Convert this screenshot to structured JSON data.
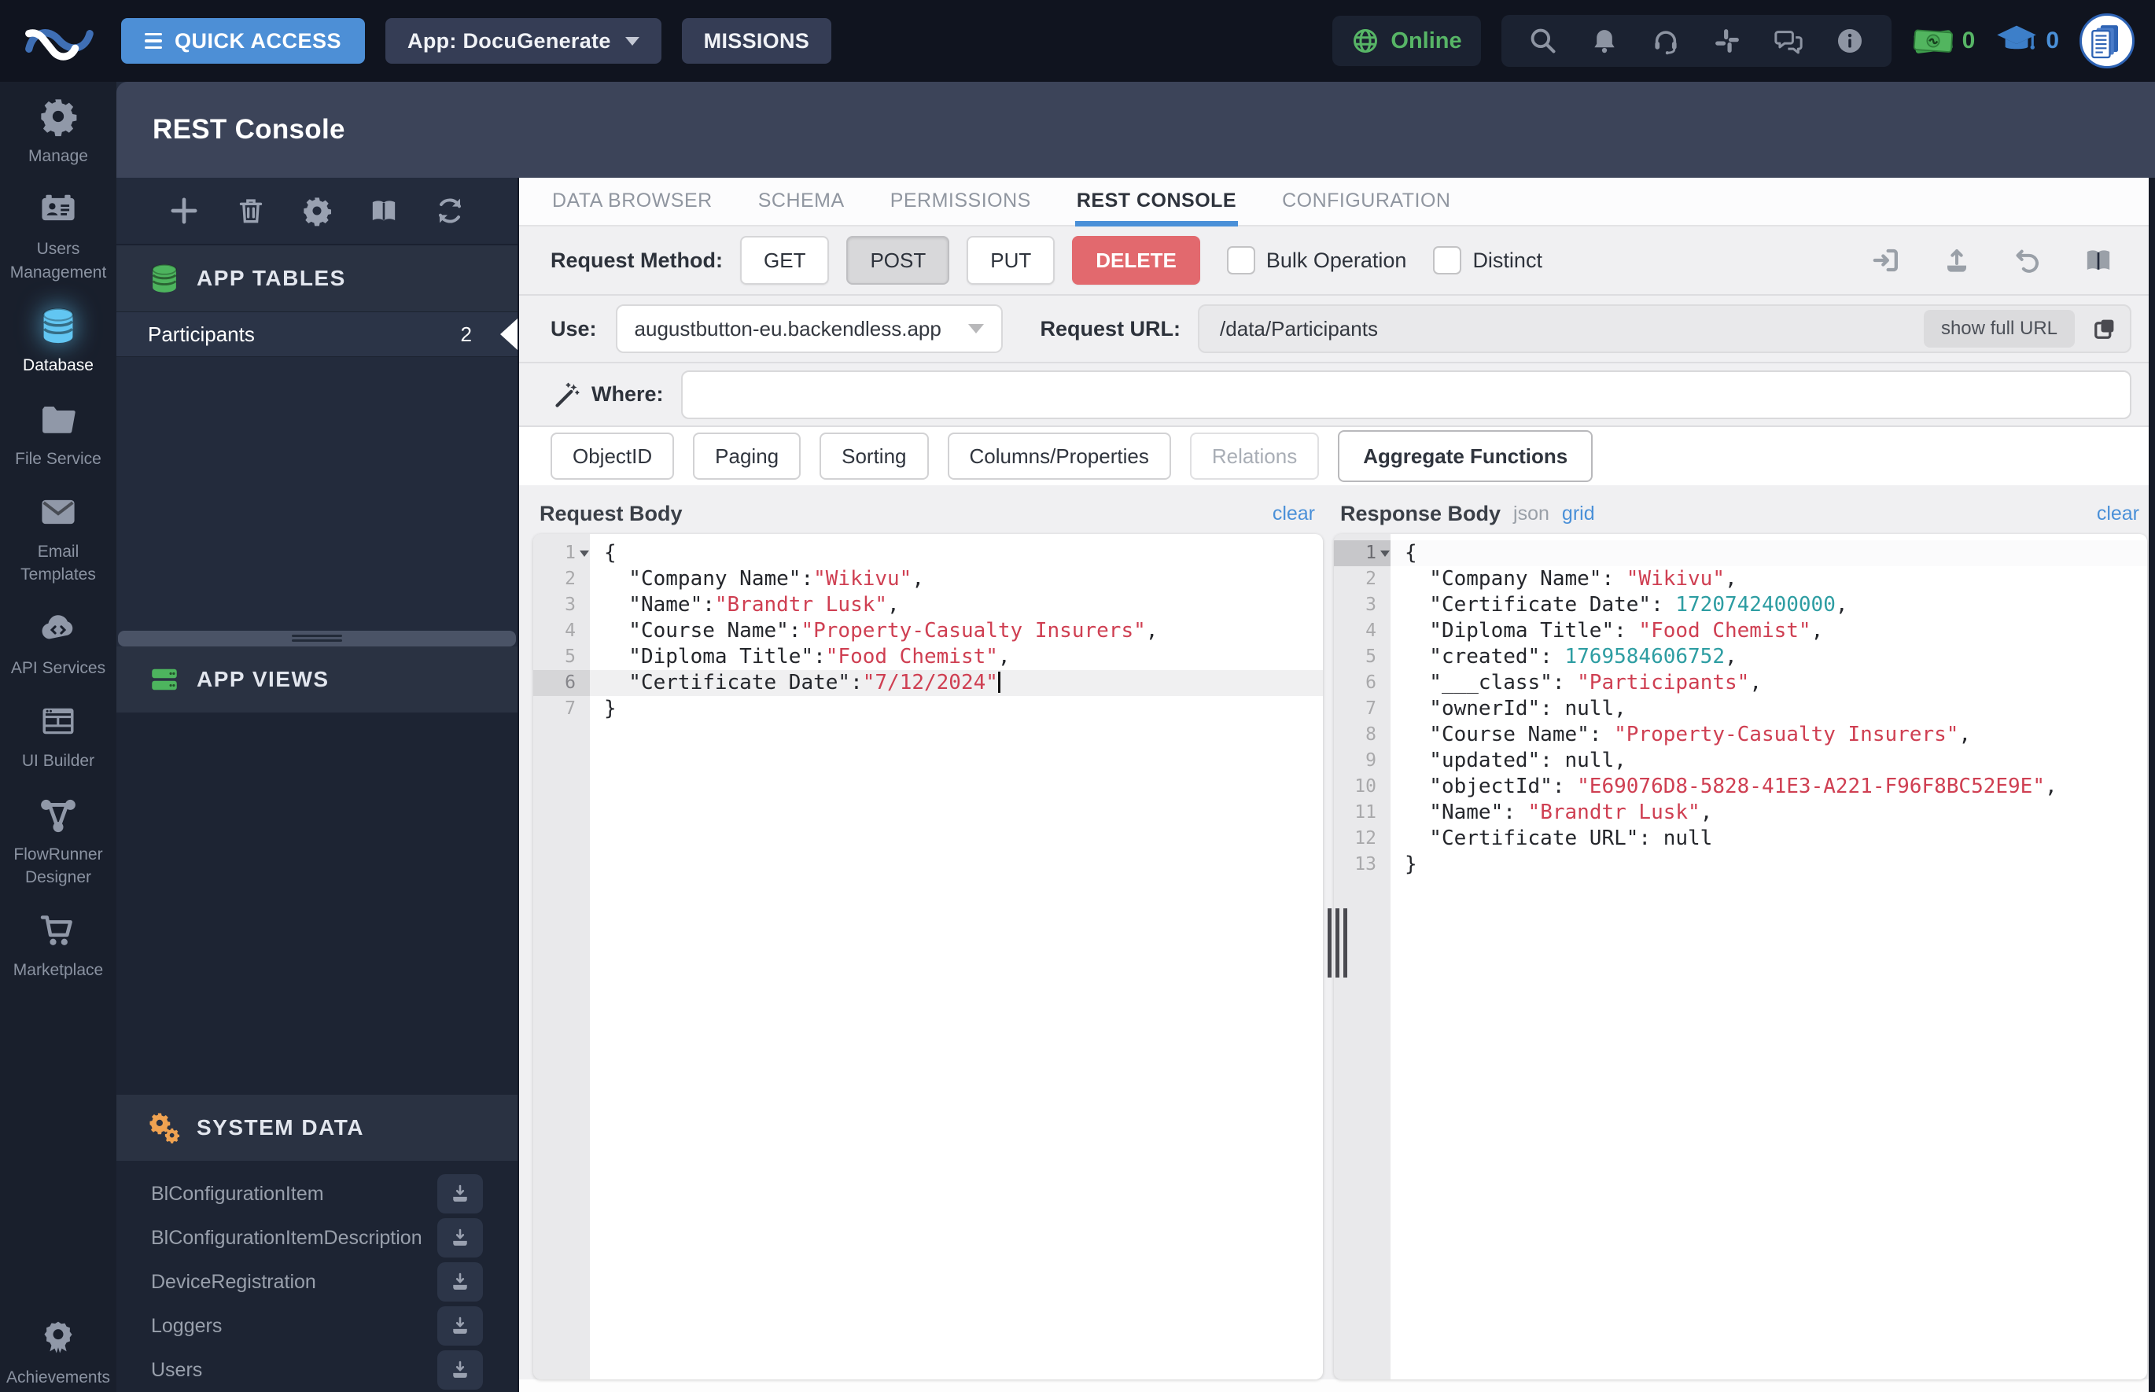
{
  "topbar": {
    "quick_access": "QUICK ACCESS",
    "app_selector": "App: DocuGenerate",
    "missions": "MISSIONS",
    "online": "Online",
    "bucks_count": "0",
    "missions_count": "0"
  },
  "sidebar": {
    "items": [
      {
        "label": "Manage",
        "icon": "gear"
      },
      {
        "label": "Users Management",
        "icon": "id-card"
      },
      {
        "label": "Database",
        "icon": "database",
        "active": true
      },
      {
        "label": "File Service",
        "icon": "folder"
      },
      {
        "label": "Email Templates",
        "icon": "envelope"
      },
      {
        "label": "API Services",
        "icon": "cloud-code"
      },
      {
        "label": "UI Builder",
        "icon": "browser"
      },
      {
        "label": "FlowRunner Designer",
        "icon": "flow"
      },
      {
        "label": "Marketplace",
        "icon": "cart"
      },
      {
        "label": "Achievements",
        "icon": "badge"
      }
    ]
  },
  "page": {
    "title": "REST Console"
  },
  "tables_panel": {
    "app_tables": "APP TABLES",
    "tables": [
      {
        "name": "Participants",
        "count": "2"
      }
    ],
    "app_views": "APP VIEWS",
    "system_data": "SYSTEM DATA",
    "system_tables": [
      "BlConfigurationItem",
      "BlConfigurationItemDescription",
      "DeviceRegistration",
      "Loggers",
      "Users"
    ]
  },
  "tabs": [
    {
      "label": "DATA BROWSER"
    },
    {
      "label": "SCHEMA"
    },
    {
      "label": "PERMISSIONS"
    },
    {
      "label": "REST CONSOLE",
      "active": true
    },
    {
      "label": "CONFIGURATION"
    }
  ],
  "request": {
    "method_label": "Request Method:",
    "methods": [
      {
        "label": "GET",
        "state": "plain"
      },
      {
        "label": "POST",
        "state": "pressed"
      },
      {
        "label": "PUT",
        "state": "plain"
      },
      {
        "label": "DELETE",
        "state": "danger"
      }
    ],
    "bulk_operation": "Bulk Operation",
    "distinct": "Distinct",
    "use_label": "Use:",
    "use_value": "augustbutton-eu.backendless.app",
    "url_label": "Request URL:",
    "url_value": "/data/Participants",
    "show_full_url": "show full URL",
    "where_label": "Where:",
    "where_value": "",
    "filters": [
      {
        "label": "ObjectID"
      },
      {
        "label": "Paging"
      },
      {
        "label": "Sorting"
      },
      {
        "label": "Columns/Properties"
      },
      {
        "label": "Relations",
        "disabled": true
      },
      {
        "label": "Aggregate Functions",
        "emph": true
      }
    ]
  },
  "request_body": {
    "title": "Request Body",
    "clear": "clear",
    "lines": [
      {
        "no": 1,
        "fold": true,
        "segs": [
          [
            "{",
            ""
          ]
        ]
      },
      {
        "no": 2,
        "segs": [
          [
            "  \"Company Name\":",
            ""
          ],
          [
            "\"Wikivu\"",
            "s"
          ],
          [
            ",",
            ""
          ]
        ]
      },
      {
        "no": 3,
        "segs": [
          [
            "  \"Name\":",
            ""
          ],
          [
            "\"Brandtr Lusk\"",
            "s"
          ],
          [
            ",",
            ""
          ]
        ]
      },
      {
        "no": 4,
        "segs": [
          [
            "  \"Course Name\":",
            ""
          ],
          [
            "\"Property-Casualty Insurers\"",
            "s"
          ],
          [
            ",",
            ""
          ]
        ]
      },
      {
        "no": 5,
        "segs": [
          [
            "  \"Diploma Title\":",
            ""
          ],
          [
            "\"Food Chemist\"",
            "s"
          ],
          [
            ",",
            ""
          ]
        ]
      },
      {
        "no": 6,
        "active": true,
        "cursor": true,
        "segs": [
          [
            "  \"Certificate Date\":",
            ""
          ],
          [
            "\"7/12/2024\"",
            "s"
          ]
        ]
      },
      {
        "no": 7,
        "segs": [
          [
            "}",
            ""
          ]
        ]
      }
    ]
  },
  "response_body": {
    "title": "Response Body",
    "mode_json": "json",
    "mode_grid": "grid",
    "clear": "clear",
    "lines": [
      {
        "no": 1,
        "fold": true,
        "hl": true,
        "segs": [
          [
            "{",
            ""
          ]
        ]
      },
      {
        "no": 2,
        "segs": [
          [
            "  \"Company Name\": ",
            ""
          ],
          [
            "\"Wikivu\"",
            "s"
          ],
          [
            ",",
            ""
          ]
        ]
      },
      {
        "no": 3,
        "segs": [
          [
            "  \"Certificate Date\": ",
            ""
          ],
          [
            "1720742400000",
            "n"
          ],
          [
            ",",
            ""
          ]
        ]
      },
      {
        "no": 4,
        "segs": [
          [
            "  \"Diploma Title\": ",
            ""
          ],
          [
            "\"Food Chemist\"",
            "s"
          ],
          [
            ",",
            ""
          ]
        ]
      },
      {
        "no": 5,
        "segs": [
          [
            "  \"created\": ",
            ""
          ],
          [
            "1769584606752",
            "n"
          ],
          [
            ",",
            ""
          ]
        ]
      },
      {
        "no": 6,
        "segs": [
          [
            "  \"___class\": ",
            ""
          ],
          [
            "\"Participants\"",
            "s"
          ],
          [
            ",",
            ""
          ]
        ]
      },
      {
        "no": 7,
        "segs": [
          [
            "  \"ownerId\": null,",
            ""
          ]
        ]
      },
      {
        "no": 8,
        "segs": [
          [
            "  \"Course Name\": ",
            ""
          ],
          [
            "\"Property-Casualty Insurers\"",
            "s"
          ],
          [
            ",",
            ""
          ]
        ]
      },
      {
        "no": 9,
        "segs": [
          [
            "  \"updated\": null,",
            ""
          ]
        ]
      },
      {
        "no": 10,
        "segs": [
          [
            "  \"objectId\": ",
            ""
          ],
          [
            "\"E69076D8-5828-41E3-A221-F96F8BC52E9E\"",
            "s"
          ],
          [
            ",",
            ""
          ]
        ]
      },
      {
        "no": 11,
        "segs": [
          [
            "  \"Name\": ",
            ""
          ],
          [
            "\"Brandtr Lusk\"",
            "s"
          ],
          [
            ",",
            ""
          ]
        ]
      },
      {
        "no": 12,
        "segs": [
          [
            "  \"Certificate URL\": null",
            ""
          ]
        ]
      },
      {
        "no": 13,
        "segs": [
          [
            "}",
            ""
          ]
        ]
      }
    ]
  },
  "colors": {
    "accent_blue": "#4a90d8",
    "delete_red": "#e2696e",
    "green": "#4db45e",
    "orange_gears": "#efa251",
    "code_string": "#cf3f52",
    "code_number": "#2d9da2",
    "topbar_bg": "#10141f",
    "panel_bg": "#232b3c",
    "header_bg": "#3c4459"
  }
}
